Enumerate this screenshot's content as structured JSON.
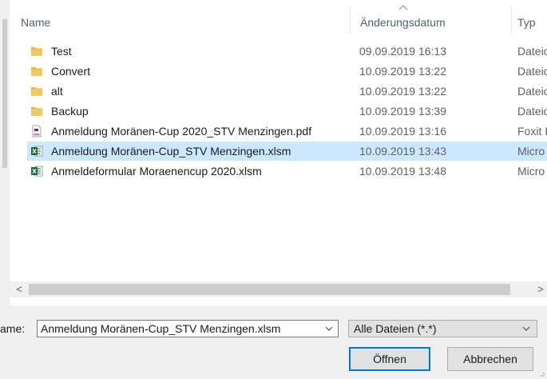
{
  "columns": {
    "name": "Name",
    "date": "Änderungsdatum",
    "type": "Typ"
  },
  "files": [
    {
      "name": "Test",
      "date": "09.09.2019 16:13",
      "type": "Dateio",
      "icon": "folder-icon",
      "selected": false
    },
    {
      "name": "Convert",
      "date": "10.09.2019 13:22",
      "type": "Dateio",
      "icon": "folder-icon",
      "selected": false
    },
    {
      "name": "alt",
      "date": "10.09.2019 13:22",
      "type": "Dateio",
      "icon": "folder-icon",
      "selected": false
    },
    {
      "name": "Backup",
      "date": "10.09.2019 13:39",
      "type": "Dateio",
      "icon": "folder-icon",
      "selected": false
    },
    {
      "name": "Anmeldung Moränen-Cup 2020_STV Menzingen.pdf",
      "date": "10.09.2019 13:16",
      "type": "Foxit I",
      "icon": "pdf-icon",
      "selected": false
    },
    {
      "name": "Anmeldung Moränen-Cup_STV Menzingen.xlsm",
      "date": "10.09.2019 13:43",
      "type": "Micro",
      "icon": "excel-icon",
      "selected": true
    },
    {
      "name": "Anmeldeformular Moraenencup 2020.xlsm",
      "date": "10.09.2019 13:48",
      "type": "Micro",
      "icon": "excel-icon",
      "selected": false
    }
  ],
  "filename": {
    "label": "ame:",
    "value": "Anmeldung Moränen-Cup_STV Menzingen.xlsm"
  },
  "filter": {
    "value": "Alle Dateien (*.*)"
  },
  "buttons": {
    "open": "Öffnen",
    "cancel": "Abbrechen"
  },
  "scroll": {
    "left_arrow": "<",
    "right_arrow": ">"
  },
  "colors": {
    "selection": "#cce8ff",
    "folder": "#e8b53f",
    "excel": "#1d6f42",
    "pdf": "#6b2c91",
    "focus": "#0078d7"
  }
}
